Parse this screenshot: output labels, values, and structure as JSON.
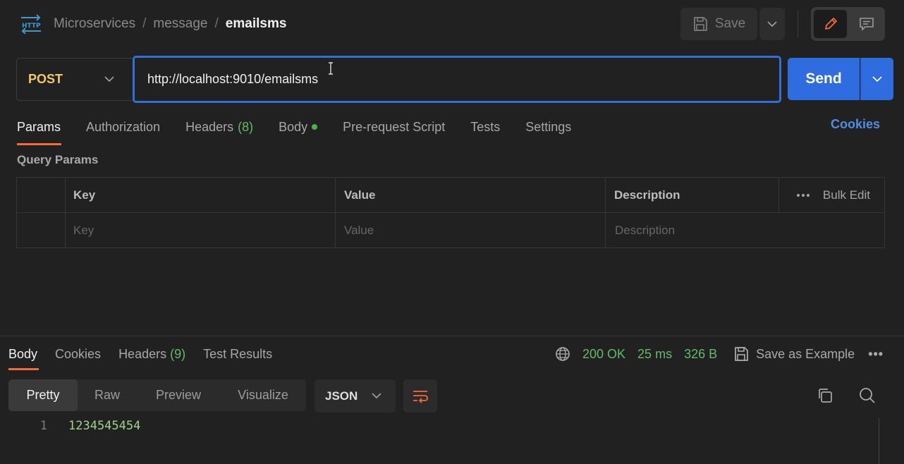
{
  "breadcrumb": {
    "icon": "http-icon",
    "segments": [
      "Microservices",
      "message"
    ],
    "separator": "/",
    "current": "emailsms"
  },
  "toolbar": {
    "save_label": "Save",
    "edit_icon": "pencil-icon",
    "comment_icon": "comment-icon"
  },
  "request": {
    "method": "POST",
    "url": "http://localhost:9010/emailsms",
    "send_label": "Send"
  },
  "request_tabs": {
    "params": "Params",
    "authorization": "Authorization",
    "headers": "Headers",
    "headers_count": "(8)",
    "body": "Body",
    "prerequest": "Pre-request Script",
    "tests": "Tests",
    "settings": "Settings",
    "cookies": "Cookies"
  },
  "query_params": {
    "title": "Query Params",
    "columns": [
      "Key",
      "Value",
      "Description"
    ],
    "bulk_edit": "Bulk Edit",
    "placeholders": [
      "Key",
      "Value",
      "Description"
    ]
  },
  "response_tabs": {
    "body": "Body",
    "cookies": "Cookies",
    "headers": "Headers",
    "headers_count": "(9)",
    "test_results": "Test Results"
  },
  "response_status": {
    "status": "200 OK",
    "time": "25 ms",
    "size": "326 B",
    "save_example": "Save as Example",
    "more": "•••"
  },
  "view_modes": [
    "Pretty",
    "Raw",
    "Preview",
    "Visualize"
  ],
  "format": "JSON",
  "response_body": {
    "line_number": "1",
    "value": "1234545454"
  },
  "colors": {
    "accent": "#f26b3a",
    "send": "#2f6ce0",
    "ok": "#65b86a",
    "method": "#f0c96a"
  }
}
